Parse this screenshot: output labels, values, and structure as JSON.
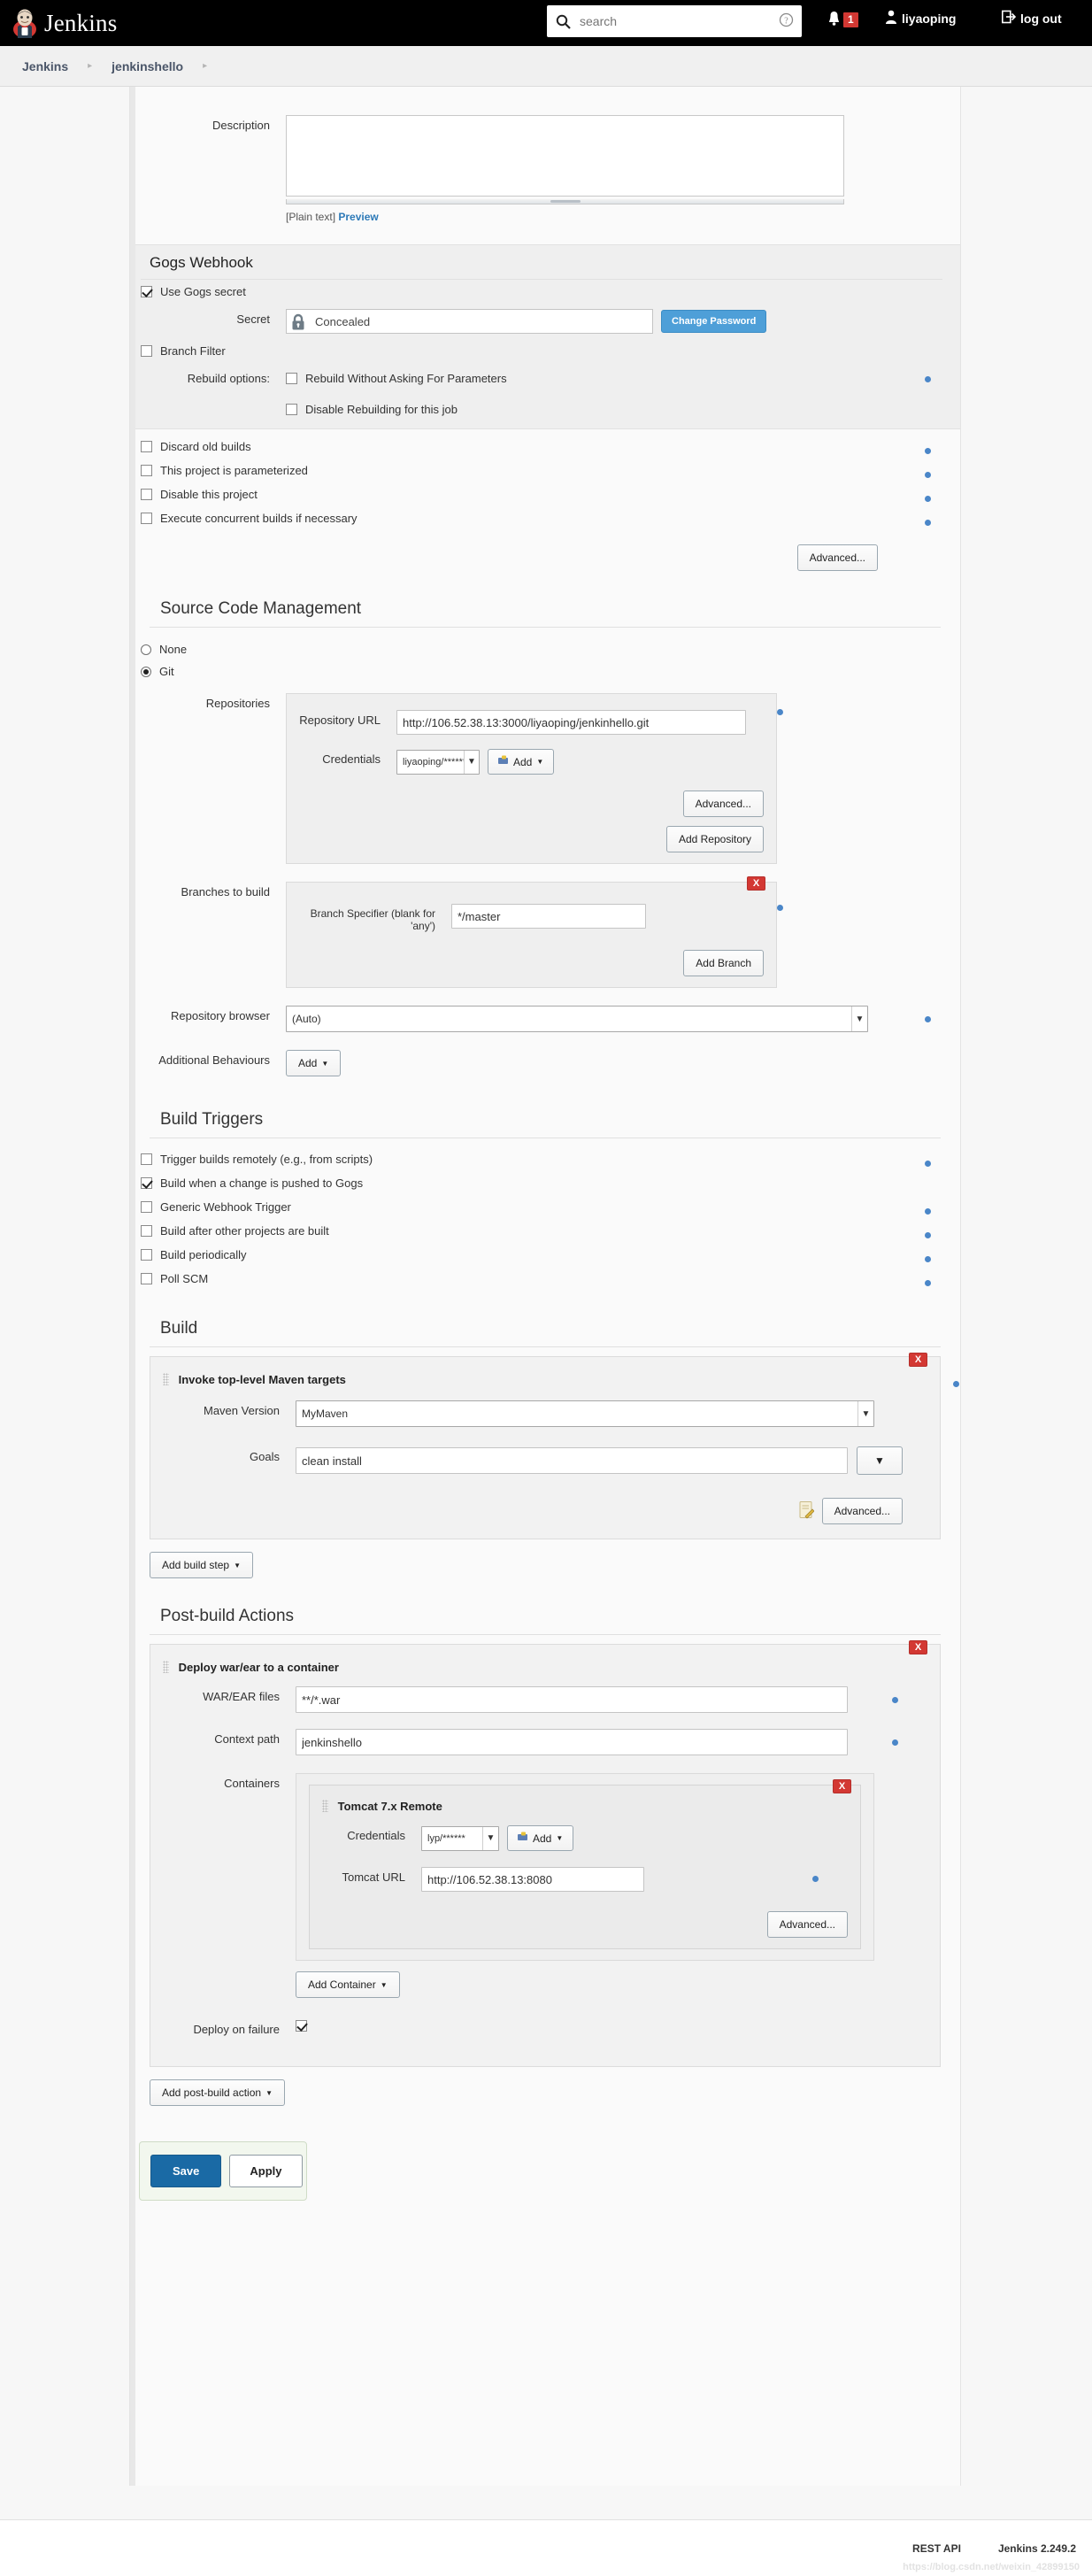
{
  "header": {
    "brand": "Jenkins",
    "logo_icon": "jenkins-butler-icon",
    "search_placeholder": "search",
    "search_value": "",
    "search_icon": "search-icon",
    "help_icon": "help-circle-icon",
    "bell_icon": "bell-icon",
    "notification_count": "1",
    "user_icon": "user-icon",
    "user_name": "liyaoping",
    "logout_icon": "logout-icon",
    "logout_label": "log out"
  },
  "breadcrumb": {
    "items": [
      "Jenkins",
      "jenkinshello"
    ],
    "separator": "▸"
  },
  "description": {
    "label": "Description",
    "value": "",
    "plain_text": "[Plain text]",
    "preview_link": "Preview"
  },
  "gogs": {
    "heading": "Gogs Webhook",
    "use_secret_label": "Use Gogs secret",
    "use_secret_checked": true,
    "secret_label": "Secret",
    "secret_value": "Concealed",
    "lock_icon": "lock-icon",
    "change_password_label": "Change Password",
    "branch_filter_label": "Branch Filter",
    "branch_filter_checked": false,
    "rebuild_options_label": "Rebuild options:",
    "rebuild_without_asking_label": "Rebuild Without Asking For Parameters",
    "rebuild_without_asking_checked": false,
    "disable_rebuilding_label": "Disable Rebuilding for this job",
    "disable_rebuilding_checked": false
  },
  "general_options": [
    {
      "label": "Discard old builds",
      "checked": false,
      "help": true
    },
    {
      "label": "This project is parameterized",
      "checked": false,
      "help": true
    },
    {
      "label": "Disable this project",
      "checked": false,
      "help": true
    },
    {
      "label": "Execute concurrent builds if necessary",
      "checked": false,
      "help": true
    }
  ],
  "general_advanced_label": "Advanced...",
  "scm": {
    "heading": "Source Code Management",
    "options": [
      {
        "label": "None",
        "selected": false
      },
      {
        "label": "Git",
        "selected": true
      }
    ],
    "repositories_label": "Repositories",
    "repository_url_label": "Repository URL",
    "repository_url_value": "http://106.52.38.13:3000/liyaoping/jenkinhello.git",
    "credentials_label": "Credentials",
    "credentials_value": "liyaoping/******",
    "add_label": "Add",
    "add_icon": "add-credentials-icon",
    "advanced_label": "Advanced...",
    "add_repository_label": "Add Repository",
    "branches_label": "Branches to build",
    "branch_specifier_label": "Branch Specifier (blank for 'any')",
    "branch_specifier_value": "*/master",
    "add_branch_label": "Add Branch",
    "delete_label": "X",
    "repository_browser_label": "Repository browser",
    "repository_browser_value": "(Auto)",
    "additional_behaviours_label": "Additional Behaviours",
    "additional_add_label": "Add"
  },
  "build_triggers": {
    "heading": "Build Triggers",
    "items": [
      {
        "label": "Trigger builds remotely (e.g., from scripts)",
        "checked": false,
        "help": true
      },
      {
        "label": "Build when a change is pushed to Gogs",
        "checked": true,
        "help": false
      },
      {
        "label": "Generic Webhook Trigger",
        "checked": false,
        "help": true
      },
      {
        "label": "Build after other projects are built",
        "checked": false,
        "help": true
      },
      {
        "label": "Build periodically",
        "checked": false,
        "help": true
      },
      {
        "label": "Poll SCM",
        "checked": false,
        "help": true
      }
    ]
  },
  "build": {
    "heading": "Build",
    "step_title": "Invoke top-level Maven targets",
    "delete_label": "X",
    "maven_version_label": "Maven Version",
    "maven_version_value": "MyMaven",
    "goals_label": "Goals",
    "goals_value": "clean install",
    "goals_dropdown_icon": "chevron-down-icon",
    "notepad_icon": "notepad-icon",
    "advanced_label": "Advanced...",
    "add_build_step_label": "Add build step"
  },
  "post_build": {
    "heading": "Post-build Actions",
    "step_title": "Deploy war/ear to a container",
    "delete_label": "X",
    "war_files_label": "WAR/EAR files",
    "war_files_value": "**/*.war",
    "context_path_label": "Context path",
    "context_path_value": "jenkinshello",
    "containers_label": "Containers",
    "container_title": "Tomcat 7.x Remote",
    "container_delete_label": "X",
    "credentials_label": "Credentials",
    "credentials_value": "lyp/******",
    "add_label": "Add",
    "tomcat_url_label": "Tomcat URL",
    "tomcat_url_value": "http://106.52.38.13:8080",
    "advanced_label": "Advanced...",
    "add_container_label": "Add Container",
    "deploy_on_failure_label": "Deploy on failure",
    "deploy_on_failure_checked": true,
    "add_post_build_action_label": "Add post-build action"
  },
  "actions": {
    "save_label": "Save",
    "apply_label": "Apply"
  },
  "footer": {
    "rest_api": "REST API",
    "version": "Jenkins 2.249.2",
    "watermark": "https://blog.csdn.net/weixin_42899150"
  },
  "colors": {
    "accent_blue": "#1a6aa5",
    "danger_red": "#d33833",
    "help_blue": "#4a86c8",
    "button_blue": "#4e9fd8"
  }
}
